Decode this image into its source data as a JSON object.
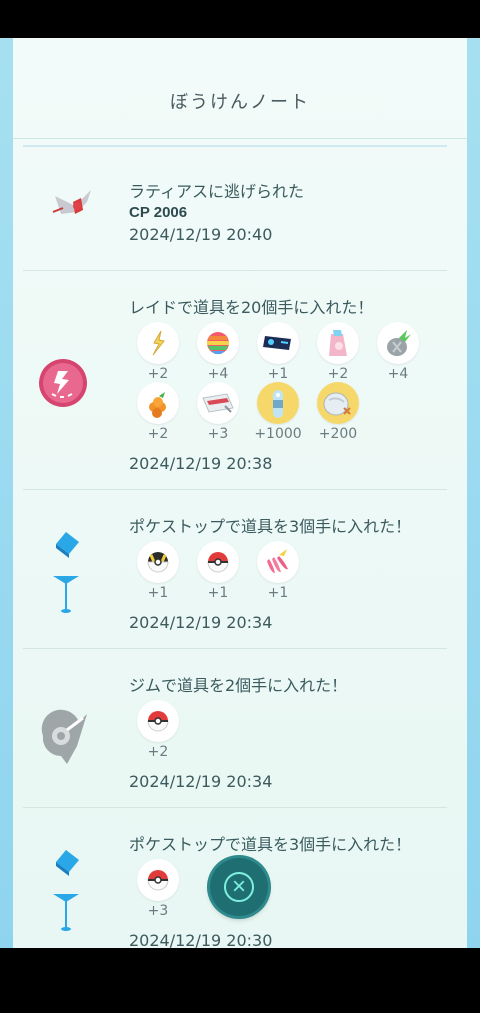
{
  "header": {
    "title": "ぼうけんノート"
  },
  "entries": [
    {
      "title": "ラティアスに逃げられた",
      "cp": "CP 2006",
      "date": "2024/12/19 20:40",
      "icon": "latias-icon"
    },
    {
      "title": "レイドで道具を20個手に入れた！",
      "date": "2024/12/19 20:38",
      "icon": "raid-pass-icon",
      "items": [
        {
          "icon": "golden-shard-icon",
          "count": "+2"
        },
        {
          "icon": "rainbow-candy-icon",
          "count": "+4"
        },
        {
          "icon": "tm-disc-icon",
          "count": "+1"
        },
        {
          "icon": "rare-candy-xl-icon",
          "count": "+2"
        },
        {
          "icon": "silver-pinap-icon",
          "count": "+4"
        },
        {
          "icon": "golden-razz-berry-icon",
          "count": "+2"
        },
        {
          "icon": "ticket-icon",
          "count": "+3"
        },
        {
          "icon": "candy-xl-icon",
          "count": "+1000"
        },
        {
          "icon": "stardust-icon",
          "count": "+200"
        }
      ]
    },
    {
      "title": "ポケストップで道具を3個手に入れた！",
      "date": "2024/12/19 20:34",
      "icon": "pokestop-icon",
      "items": [
        {
          "icon": "ultra-ball-icon",
          "count": "+1"
        },
        {
          "icon": "poke-ball-icon",
          "count": "+1"
        },
        {
          "icon": "pinap-berry-icon",
          "count": "+1"
        }
      ]
    },
    {
      "title": "ジムで道具を2個手に入れた！",
      "date": "2024/12/19 20:34",
      "icon": "gym-icon",
      "items": [
        {
          "icon": "poke-ball-icon",
          "count": "+2"
        }
      ]
    },
    {
      "title": "ポケストップで道具を3個手に入れた！",
      "date": "2024/12/19 20:30",
      "icon": "pokestop-icon",
      "items": [
        {
          "icon": "poke-ball-icon",
          "count": "+3"
        }
      ]
    }
  ],
  "close_button": {
    "icon": "close-icon"
  }
}
